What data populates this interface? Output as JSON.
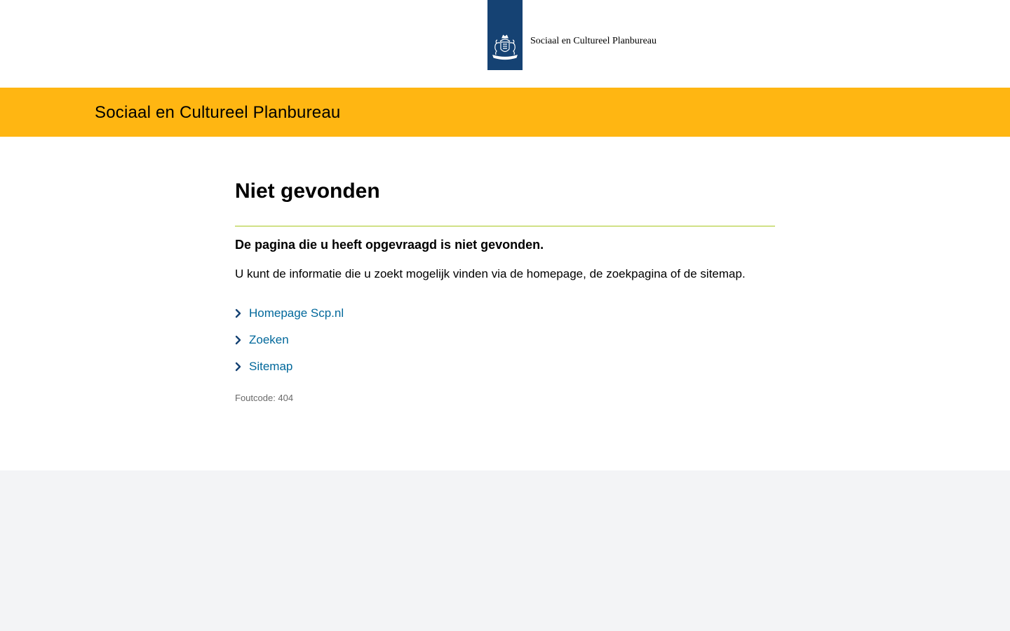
{
  "header": {
    "logo_wordmark": "Sociaal en Cultureel Planbureau",
    "logo_ribbon_color": "#154273"
  },
  "banner": {
    "title": "Sociaal en Cultureel Planbureau",
    "color": "#ffb612"
  },
  "main": {
    "title": "Niet gevonden",
    "lead": "De pagina die u heeft opgevraagd is niet gevonden.",
    "intro": "U kunt de informatie die u zoekt mogelijk vinden via de homepage, de zoekpagina of de sitemap.",
    "links": [
      {
        "label": "Homepage Scp.nl",
        "icon": "chevron-right-icon"
      },
      {
        "label": "Zoeken",
        "icon": "chevron-right-icon"
      },
      {
        "label": "Sitemap",
        "icon": "chevron-right-icon"
      }
    ],
    "error_code": "Foutcode: 404"
  },
  "colors": {
    "link": "#01689b",
    "divider": "#a9c61f",
    "footer_bg": "#f3f4f6"
  }
}
